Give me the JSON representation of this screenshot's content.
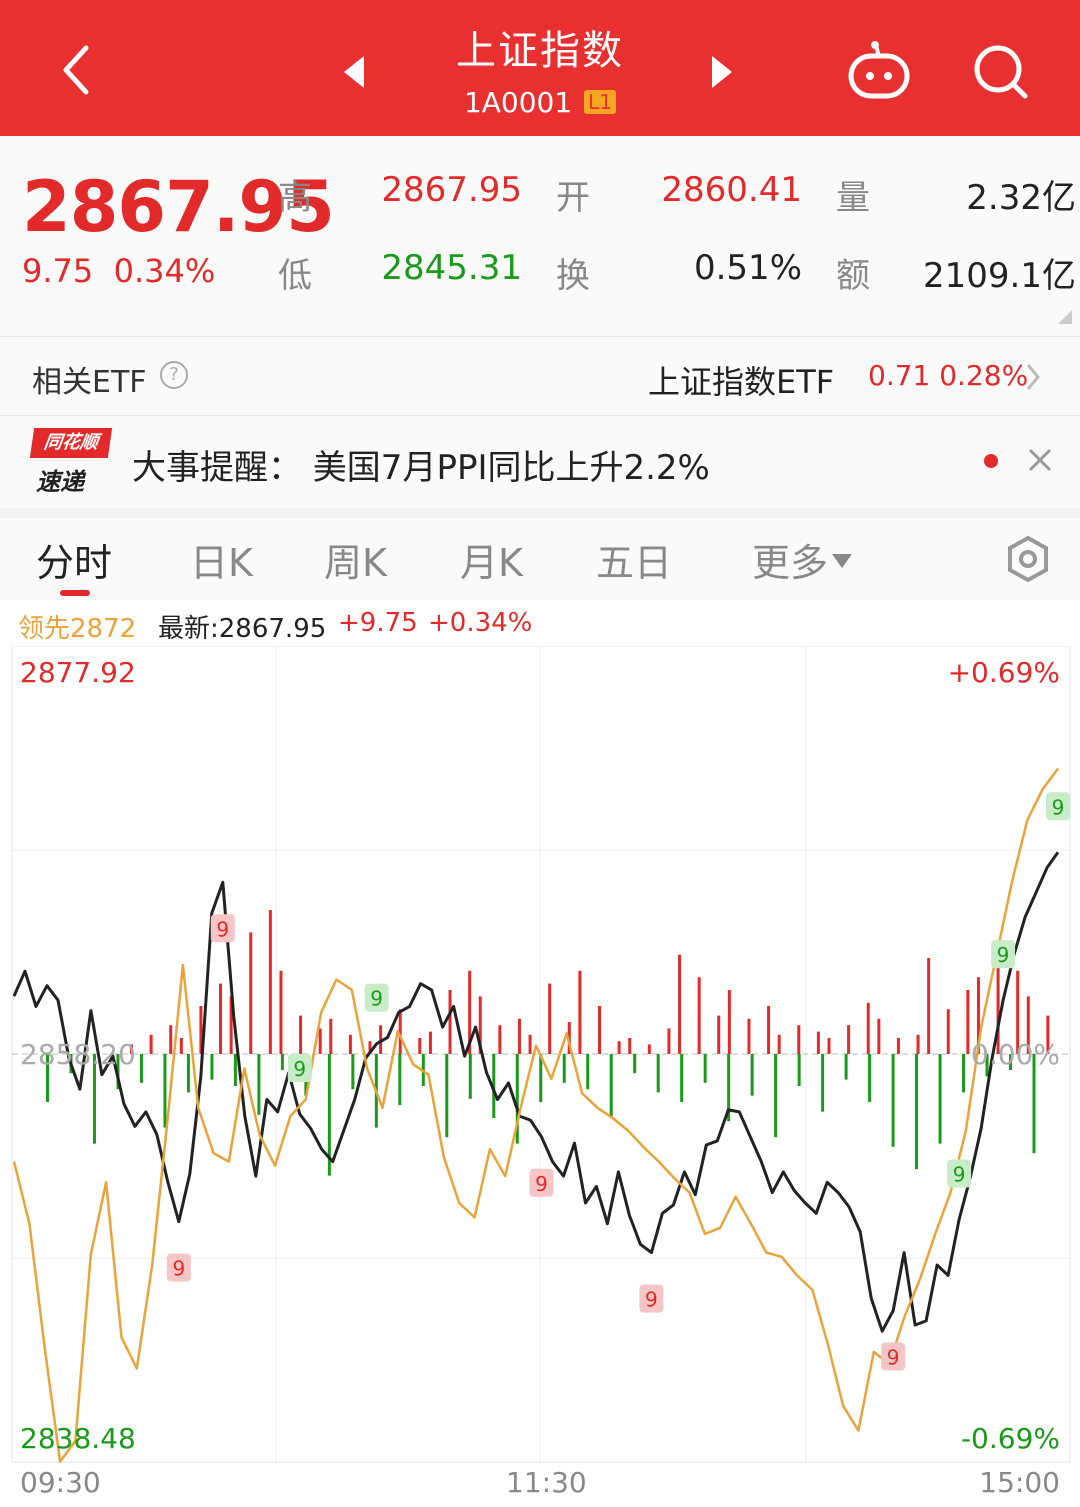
{
  "header": {
    "title": "上证指数",
    "code": "1A0001",
    "level_badge": "L1",
    "icons": [
      "back-chevron-icon",
      "prev-triangle-icon",
      "next-triangle-icon",
      "robot-icon",
      "search-icon"
    ],
    "color": "#e93030"
  },
  "quote": {
    "price": "2867.95",
    "change": "9.75",
    "change_pct": "0.34%",
    "high_label": "高",
    "high": "2867.95",
    "low_label": "低",
    "low": "2845.31",
    "open_label": "开",
    "open": "2860.41",
    "turnover_label": "换",
    "turnover": "0.51%",
    "volume_label": "量",
    "volume": "2.32亿",
    "amount_label": "额",
    "amount": "2109.1亿"
  },
  "etf": {
    "label": "相关ETF",
    "help": "?",
    "name": "上证指数ETF",
    "value": "0.71 0.28%"
  },
  "news": {
    "logo_top": "同花顺",
    "logo_bottom": "速递",
    "text": "大事提醒：  美国7月PPI同比上升2.2%"
  },
  "tabs": {
    "items": [
      "分时",
      "日K",
      "周K",
      "月K",
      "五日",
      "更多"
    ],
    "active": 0
  },
  "info": {
    "lead": "领先2872",
    "latest": "最新:2867.95",
    "change": "+9.75",
    "change_pct": "+0.34%"
  },
  "chart_data": {
    "type": "line",
    "y_max_label": "2877.92",
    "y_min_label": "2838.48",
    "y_mid_label": "2858.20",
    "pct_max_label": "+0.69%",
    "pct_min_label": "-0.69%",
    "pct_mid_label": "0.00%",
    "ylim": [
      2838.48,
      2877.92
    ],
    "x_labels": [
      "09:30",
      "11:30",
      "15:00"
    ],
    "series": [
      {
        "color": "#222222",
        "values": [
          2861.0,
          2862.2,
          2860.5,
          2861.5,
          2860.8,
          2858.0,
          2856.5,
          2860.3,
          2857.2,
          2858.1,
          2855.8,
          2854.7,
          2855.4,
          2854.3,
          2852.0,
          2850.1,
          2852.4,
          2857.1,
          2865.0,
          2866.5,
          2860.0,
          2855.2,
          2852.3,
          2856.0,
          2855.4,
          2857.3,
          2855.3,
          2854.6,
          2853.6,
          2853.0,
          2854.5,
          2856.0,
          2858.0,
          2858.7,
          2859.0,
          2860.2,
          2860.5,
          2861.6,
          2861.3,
          2859.5,
          2860.5,
          2858.1,
          2859.5,
          2857.3,
          2856.0,
          2856.8,
          2855.2,
          2855.0,
          2854.2,
          2853.0,
          2852.3,
          2853.9,
          2851.0,
          2851.8,
          2850.0,
          2852.5,
          2850.4,
          2849.0,
          2848.6,
          2850.5,
          2850.9,
          2852.5,
          2851.4,
          2853.8,
          2854.0,
          2855.5,
          2855.4,
          2854.2,
          2853.0,
          2851.5,
          2852.5,
          2851.6,
          2851.0,
          2850.5,
          2852.0,
          2851.5,
          2850.8,
          2849.6,
          2846.4,
          2844.8,
          2845.8,
          2848.6,
          2845.1,
          2845.3,
          2848.0,
          2847.5,
          2850.2,
          2852.2,
          2854.6,
          2858.0,
          2860.8,
          2863.0,
          2864.8,
          2866.0,
          2867.2,
          2867.95
        ]
      },
      {
        "color": "#e8a33a",
        "values": [
          2853.0,
          2850.0,
          2844.0,
          2838.5,
          2839.5,
          2848.5,
          2852.0,
          2844.5,
          2843.0,
          2848.0,
          2855.0,
          2862.5,
          2855.6,
          2853.4,
          2853.0,
          2857.5,
          2854.3,
          2852.8,
          2855.2,
          2856.0,
          2860.2,
          2861.8,
          2861.3,
          2857.5,
          2855.6,
          2859.3,
          2857.7,
          2857.2,
          2853.2,
          2851.0,
          2850.3,
          2853.6,
          2852.3,
          2855.6,
          2858.6,
          2857.0,
          2859.2,
          2856.3,
          2855.6,
          2855.1,
          2854.5,
          2853.7,
          2853.0,
          2852.2,
          2851.5,
          2849.5,
          2849.8,
          2851.3,
          2850.0,
          2848.6,
          2848.4,
          2847.5,
          2846.8,
          2844.2,
          2841.2,
          2840.0,
          2843.8,
          2843.2,
          2845.5,
          2847.3,
          2849.5,
          2851.5,
          2854.5,
          2859.5,
          2863.0,
          2866.5,
          2869.5,
          2871.0,
          2872.0
        ]
      },
      {
        "color": "#e22a2a",
        "role": "volume-up",
        "values": [
          0.3,
          0.6,
          0.9,
          0.5,
          1.5,
          2.2,
          1.8,
          3.8,
          4.5,
          2.6,
          1.2,
          0.8,
          1.1,
          0.6,
          0.4,
          0.9,
          1.4,
          0.5,
          0.7,
          2.0,
          2.6,
          1.8,
          0.9,
          1.1,
          0.6,
          2.2,
          1.0,
          2.6,
          1.5,
          0.4,
          0.5,
          0.3,
          0.8,
          3.1,
          2.4,
          1.2,
          2.0,
          1.1,
          1.5,
          0.6,
          0.9,
          0.7,
          0.5,
          0.9,
          1.6,
          1.1,
          0.5,
          0.6,
          3.0,
          1.4,
          2.0,
          2.4,
          3.2,
          2.6,
          1.8,
          1.2
        ]
      },
      {
        "color": "#1a9a1a",
        "role": "volume-down",
        "values": [
          -1.5,
          -0.6,
          -2.8,
          -1.1,
          -0.9,
          -2.3,
          -1.2,
          -0.8,
          -1.0,
          -1.9,
          -0.5,
          -1.3,
          -3.8,
          -1.1,
          -2.3,
          -1.6,
          -1.0,
          -2.6,
          -1.4,
          -2.0,
          -2.8,
          -1.5,
          -0.9,
          -1.1,
          -2.0,
          -0.6,
          -1.2,
          -1.5,
          -0.9,
          -2.1,
          -1.3,
          -2.6,
          -1.0,
          -1.8,
          -0.8,
          -1.5,
          -2.9,
          -3.6,
          -2.8,
          -1.2,
          -0.7,
          -0.5,
          -3.1
        ]
      }
    ],
    "markers": [
      "9",
      "9",
      "9",
      "9",
      "9",
      "9",
      "9",
      "9",
      "9",
      "9"
    ],
    "marker_colors": {
      "up": "#c8ecc8",
      "down": "#f6c6c6"
    }
  }
}
